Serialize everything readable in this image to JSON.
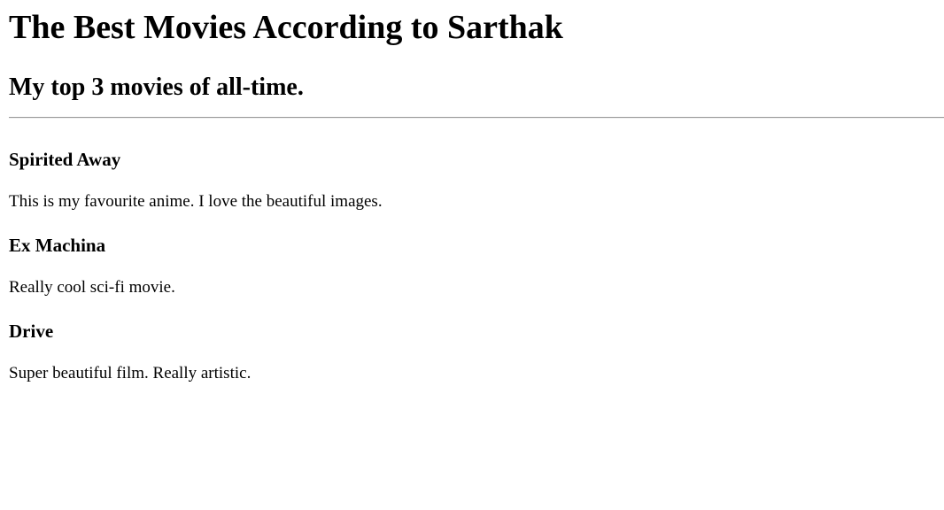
{
  "page": {
    "title": "The Best Movies According to Sarthak",
    "subtitle": "My top 3 movies of all-time."
  },
  "movies": [
    {
      "title": "Spirited Away",
      "description": "This is my favourite anime. I love the beautiful images."
    },
    {
      "title": "Ex Machina",
      "description": "Really cool sci-fi movie."
    },
    {
      "title": "Drive",
      "description": "Super beautiful film. Really artistic."
    }
  ]
}
